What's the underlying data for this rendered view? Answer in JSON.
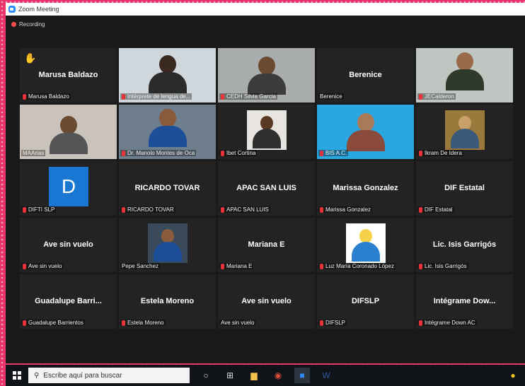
{
  "window": {
    "title": "Zoom Meeting",
    "recording": "Recording"
  },
  "participants": [
    {
      "big": "Marusa Baldazo",
      "label": "Marusa Baldazo",
      "hand": true,
      "muted": true
    },
    {
      "big": "",
      "label": "Intérprete de lengua de...",
      "video": "interpreter",
      "muted": true
    },
    {
      "big": "",
      "label": "CEDH Silvia Garcia",
      "video": "silvia",
      "muted": true
    },
    {
      "big": "Berenice",
      "label": "Berenice",
      "muted": false
    },
    {
      "big": "",
      "label": "JECalderon",
      "video": "calderon",
      "muted": true
    },
    {
      "big": "",
      "label": "MAArias",
      "video": "arias",
      "muted": false
    },
    {
      "big": "",
      "label": "Dr. Manolo Montes de Oca",
      "video": "manolo",
      "muted": true
    },
    {
      "big": "",
      "label": "Ibet Cortina",
      "video": "ibet",
      "muted": true
    },
    {
      "big": "",
      "label": "BIS A.C.",
      "video": "bis",
      "muted": true
    },
    {
      "big": "",
      "label": "Ikram De Idera",
      "video": "ikram",
      "muted": true
    },
    {
      "big": "",
      "label": "DIFTI SLP",
      "logo": "D",
      "muted": true
    },
    {
      "big": "RICARDO TOVAR",
      "label": "RICARDO TOVAR",
      "muted": true
    },
    {
      "big": "APAC SAN LUIS",
      "label": "APAC SAN LUIS",
      "muted": true
    },
    {
      "big": "Marissa Gonzalez",
      "label": "Marissa Gonzalez",
      "muted": true
    },
    {
      "big": "DIF Estatal",
      "label": "DIF Estatal",
      "muted": true
    },
    {
      "big": "Ave sin vuelo",
      "label": "Ave sin vuelo",
      "muted": true
    },
    {
      "big": "",
      "label": "Pepe Sanchez",
      "video": "pepe",
      "muted": false
    },
    {
      "big": "Mariana E",
      "label": "Mariana E",
      "muted": true
    },
    {
      "big": "",
      "label": "Luz María Coronado López",
      "video": "luz",
      "muted": true
    },
    {
      "big": "Lic. Isis Garrigós",
      "label": "Lic. Isis Garrigós",
      "muted": true
    },
    {
      "big": "Guadalupe Barri...",
      "label": "Guadalupe Barrientos",
      "muted": true
    },
    {
      "big": "Estela Moreno",
      "label": "Estela Moreno",
      "muted": true
    },
    {
      "big": "Ave sin vuelo",
      "label": "Ave sin vuelo",
      "muted": false
    },
    {
      "big": "DIFSLP",
      "label": "DIFSLP",
      "muted": true
    },
    {
      "big": "Intégrame Dow...",
      "label": "Intégrame Down AC",
      "muted": true
    }
  ],
  "taskbar": {
    "search_placeholder": "Escribe aquí para buscar"
  }
}
